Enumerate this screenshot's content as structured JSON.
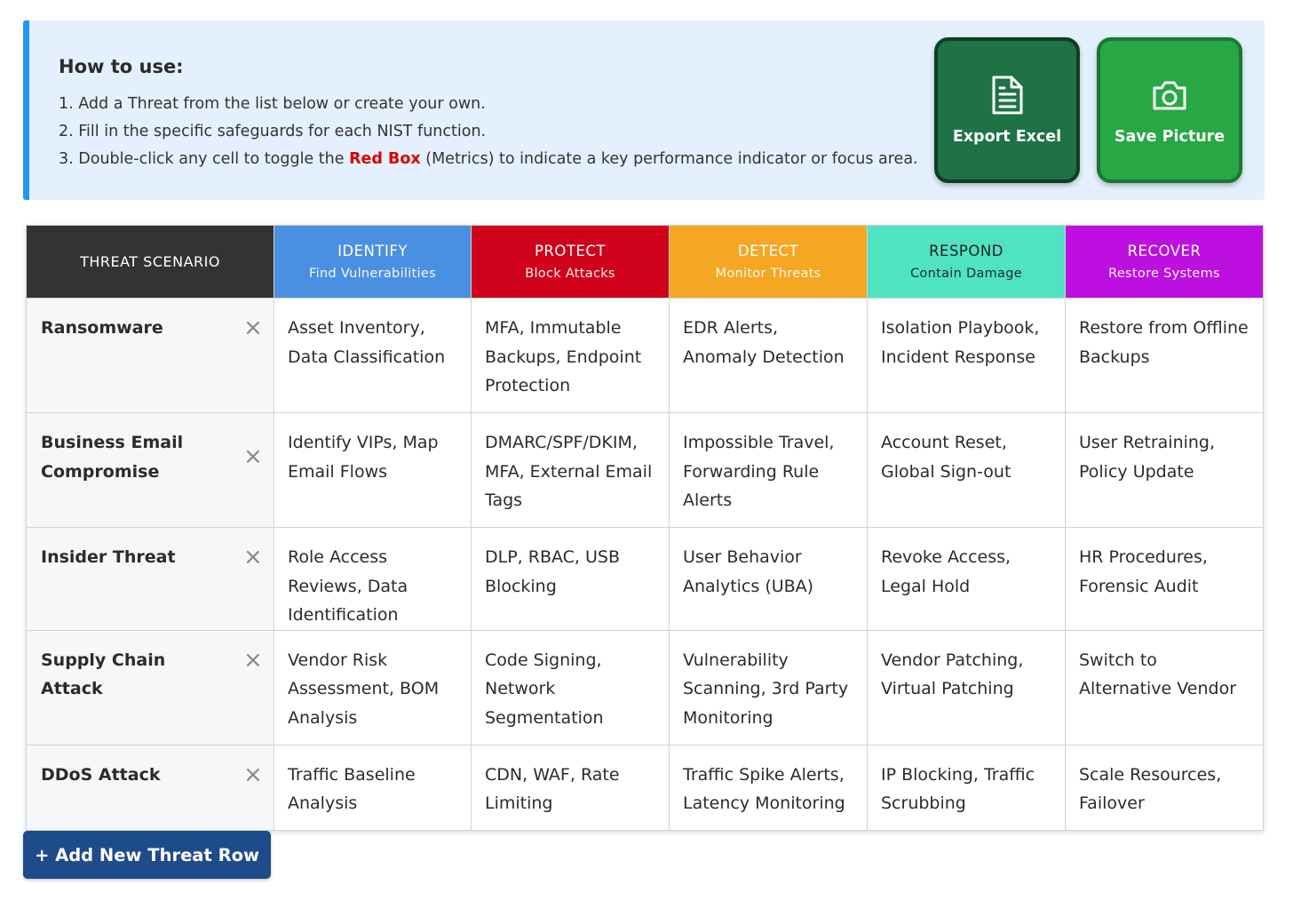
{
  "instructions": {
    "title": "How to use:",
    "step1": "1. Add a Threat from the list below or create your own.",
    "step2": "2. Fill in the specific safeguards for each NIST function.",
    "step3_before": "3. Double-click any cell to toggle the ",
    "step3_highlight": "Red Box",
    "step3_after": " (Metrics) to indicate a key performance indicator or focus area."
  },
  "buttons": {
    "export_excel": "Export Excel",
    "save_picture": "Save Picture",
    "add_row": "+ Add New Threat Row"
  },
  "icons": {
    "export": "document-icon",
    "picture": "camera-icon",
    "remove": "close-icon"
  },
  "header": {
    "threat": "THREAT SCENARIO",
    "identify": {
      "name": "IDENTIFY",
      "sub": "Find Vulnerabilities",
      "color": "#4a90e2"
    },
    "protect": {
      "name": "PROTECT",
      "sub": "Block Attacks",
      "color": "#d0021b"
    },
    "detect": {
      "name": "DETECT",
      "sub": "Monitor Threats",
      "color": "#f5a623"
    },
    "respond": {
      "name": "RESPOND",
      "sub": "Contain Damage",
      "color": "#50e3c2"
    },
    "recover": {
      "name": "RECOVER",
      "sub": "Restore Systems",
      "color": "#bd10e0"
    }
  },
  "rows": [
    {
      "threat": "Ransomware",
      "identify": "Asset Inventory, Data Classification",
      "protect": "MFA, Immutable Backups, Endpoint Protection",
      "detect": "EDR Alerts, Anomaly Detection",
      "respond": "Isolation Playbook, Incident Response",
      "recover": "Restore from Offline Backups"
    },
    {
      "threat": "Business Email Compromise",
      "identify": "Identify VIPs, Map Email Flows",
      "protect": "DMARC/SPF/DKIM, MFA, External Email Tags",
      "detect": "Impossible Travel, Forwarding Rule Alerts",
      "respond": "Account Reset, Global Sign-out",
      "recover": "User Retraining, Policy Update"
    },
    {
      "threat": "Insider Threat",
      "identify": "Role Access Reviews, Data Identification",
      "protect": "DLP, RBAC, USB Blocking",
      "detect": "User Behavior Analytics (UBA)",
      "respond": "Revoke Access, Legal Hold",
      "recover": "HR Procedures, Forensic Audit"
    },
    {
      "threat": "Supply Chain Attack",
      "identify": "Vendor Risk Assessment, BOM Analysis",
      "protect": "Code Signing, Network Segmentation",
      "detect": "Vulnerability Scanning, 3rd Party Monitoring",
      "respond": "Vendor Patching, Virtual Patching",
      "recover": "Switch to Alternative Vendor"
    },
    {
      "threat": "DDoS Attack",
      "identify": "Traffic Baseline Analysis",
      "protect": "CDN, WAF, Rate Limiting",
      "detect": "Traffic Spike Alerts, Latency Monitoring",
      "respond": "IP Blocking, Traffic Scrubbing",
      "recover": "Scale Resources, Failover"
    }
  ]
}
